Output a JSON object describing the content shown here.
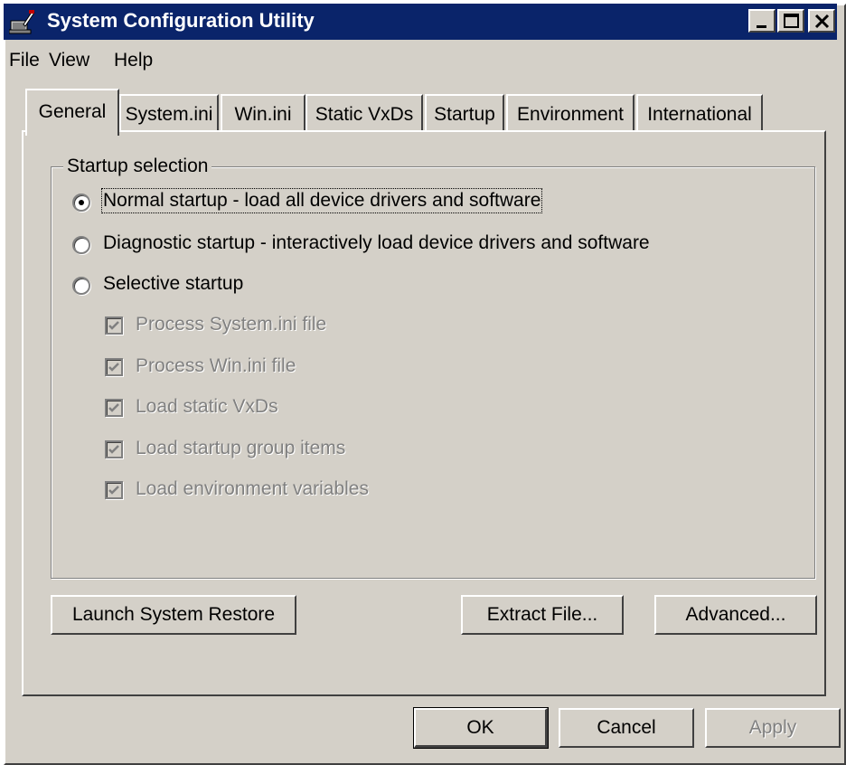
{
  "window": {
    "title": "System Configuration Utility"
  },
  "menu": {
    "file": "File",
    "view": "View",
    "help": "Help"
  },
  "tabs": [
    {
      "label": "General",
      "active": true
    },
    {
      "label": "System.ini"
    },
    {
      "label": "Win.ini"
    },
    {
      "label": "Static VxDs"
    },
    {
      "label": "Startup"
    },
    {
      "label": "Environment"
    },
    {
      "label": "International"
    }
  ],
  "startup": {
    "group_label": "Startup selection",
    "normal": {
      "label": "Normal startup - load all device drivers and software",
      "selected": true
    },
    "diagnostic": {
      "label": "Diagnostic startup - interactively load device drivers and software",
      "selected": false
    },
    "selective": {
      "label": "Selective startup",
      "selected": false
    },
    "options": [
      {
        "label": "Process System.ini file",
        "checked": true,
        "enabled": false
      },
      {
        "label": "Process Win.ini file",
        "checked": true,
        "enabled": false
      },
      {
        "label": "Load static VxDs",
        "checked": true,
        "enabled": false
      },
      {
        "label": "Load startup group items",
        "checked": true,
        "enabled": false
      },
      {
        "label": "Load environment variables",
        "checked": true,
        "enabled": false
      }
    ]
  },
  "buttons": {
    "launch_restore": "Launch System Restore",
    "extract_file": "Extract File...",
    "advanced": "Advanced...",
    "ok": "OK",
    "cancel": "Cancel",
    "apply": "Apply"
  },
  "colors": {
    "titlebar": "#0a246a",
    "face": "#d4d0c8",
    "disabled_text": "#808080"
  }
}
